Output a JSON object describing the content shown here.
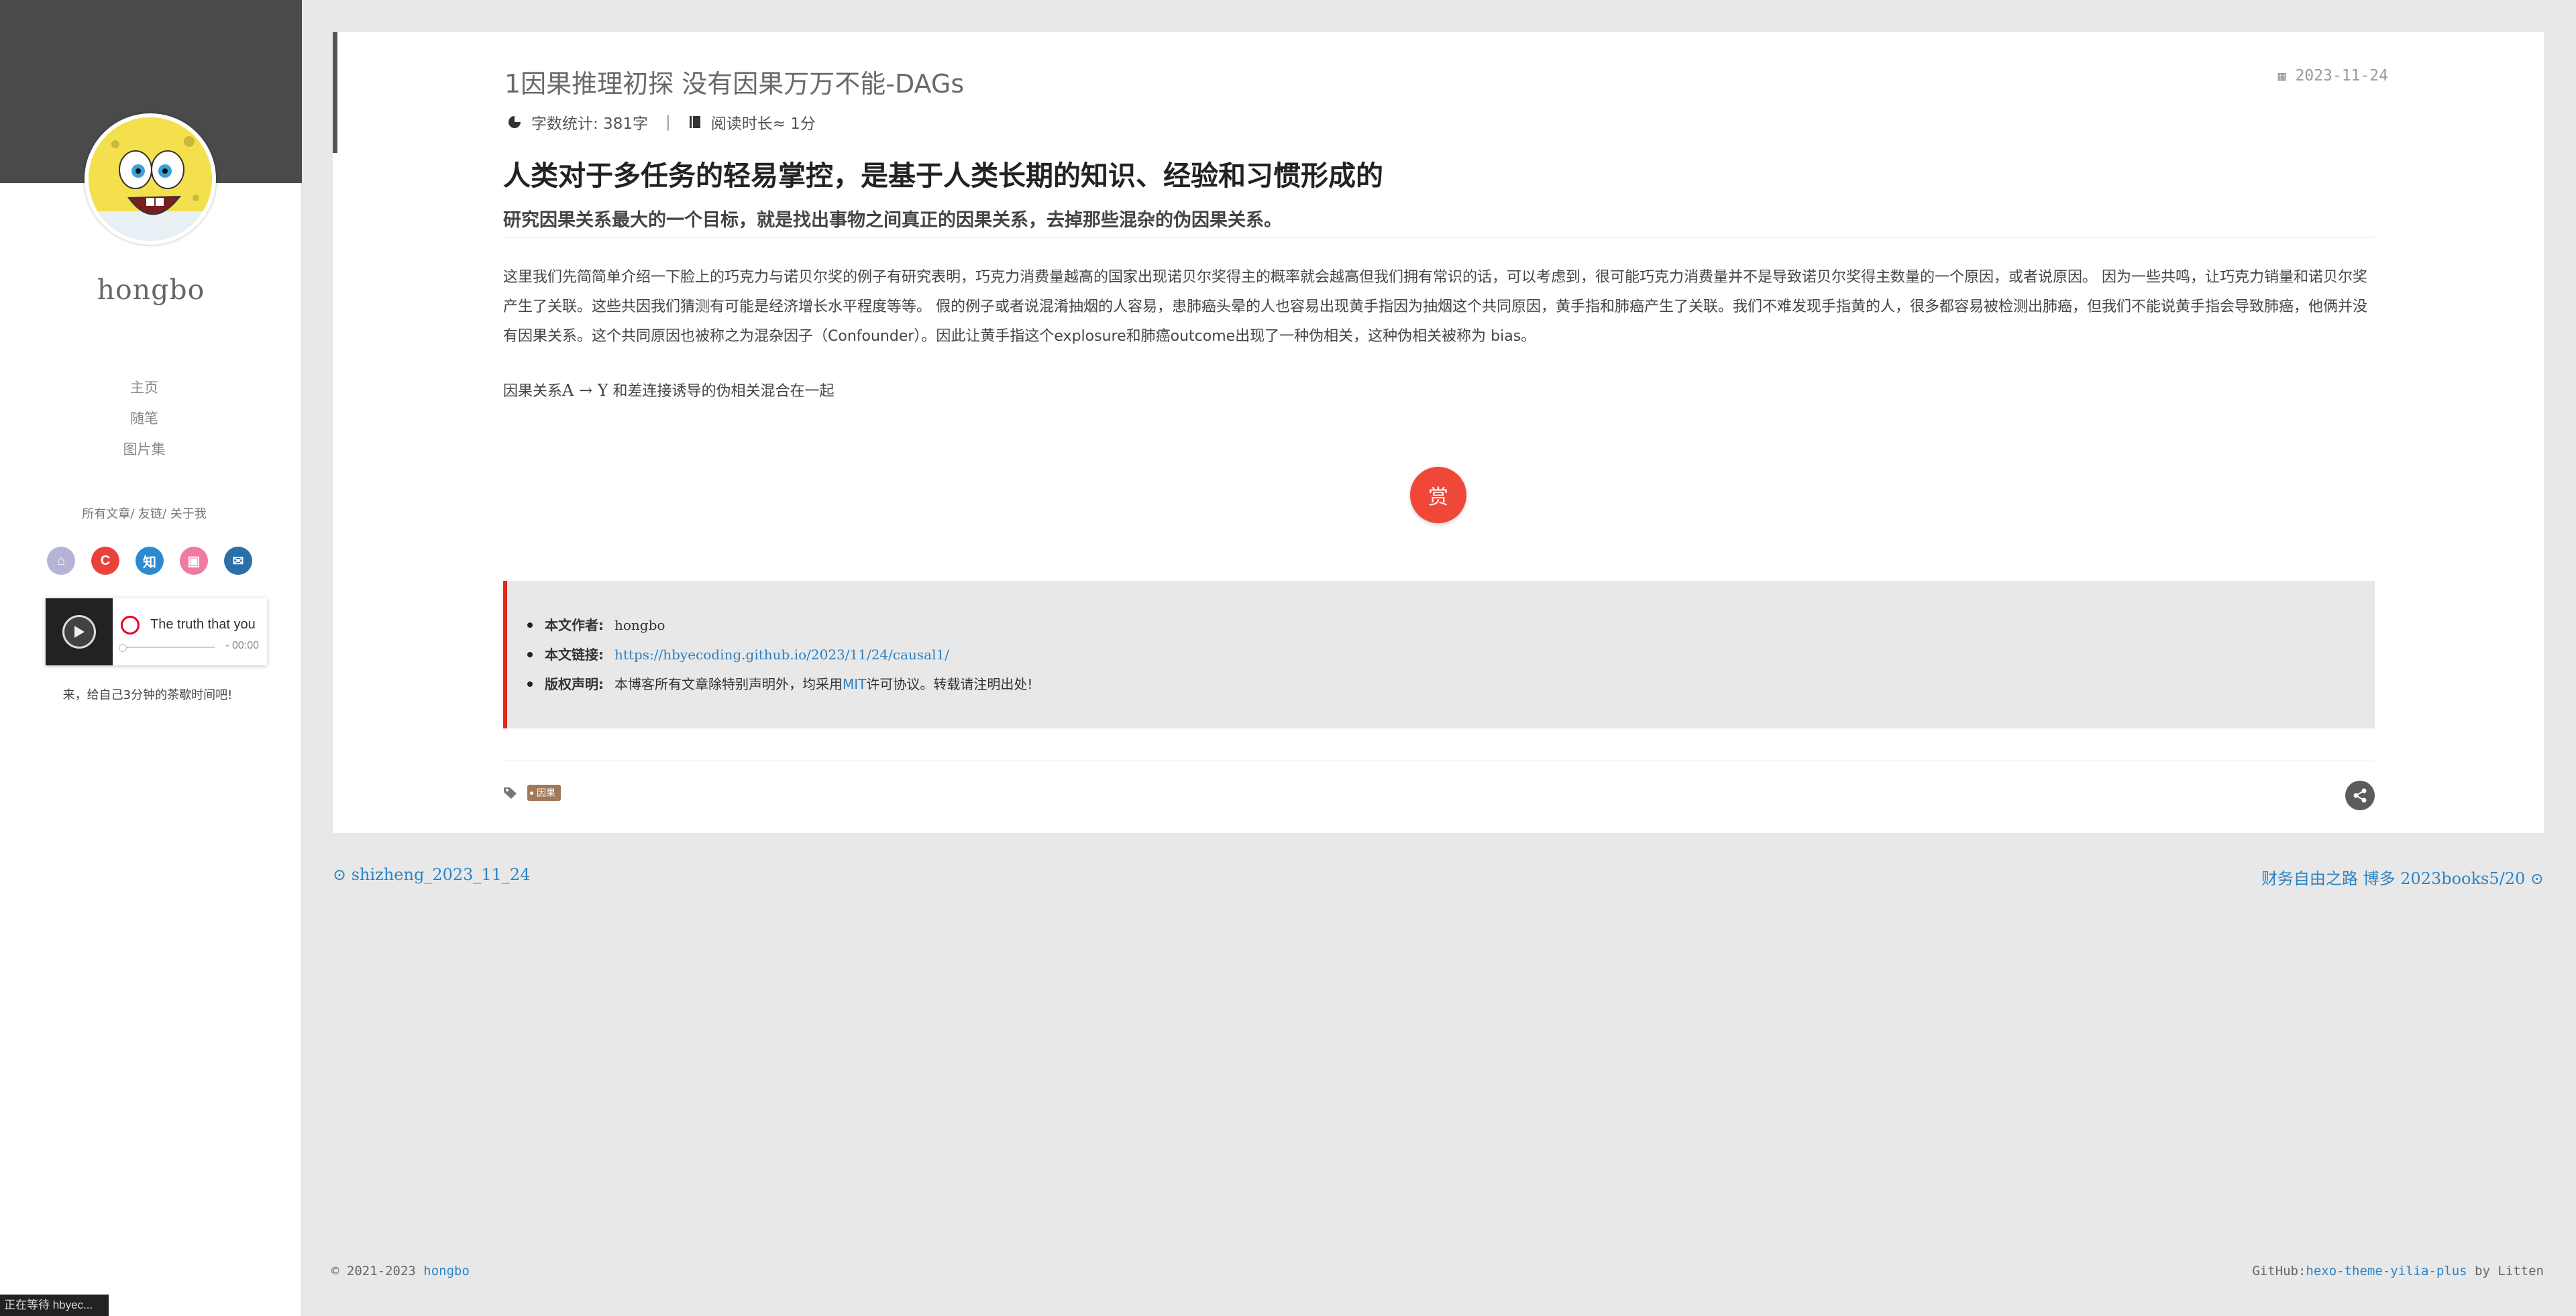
{
  "sidebar": {
    "site_name": "hongbo",
    "nav": [
      "主页",
      "随笔",
      "图片集"
    ],
    "sub_links": [
      "所有文章",
      "友链",
      "关于我"
    ],
    "social_icons": [
      {
        "name": "github-icon",
        "color": "#b5b3d6",
        "glyph": "⌂"
      },
      {
        "name": "csdn-icon",
        "color": "#e8433b",
        "glyph": "C"
      },
      {
        "name": "zhihu-icon",
        "color": "#2e8ad0",
        "glyph": "知"
      },
      {
        "name": "bilibili-icon",
        "color": "#f07aa0",
        "glyph": "▣"
      },
      {
        "name": "email-icon",
        "color": "#2b6fa8",
        "glyph": "✉"
      }
    ],
    "player": {
      "song": "The truth that you",
      "time": "- 00:00"
    },
    "motto": "来，给自己3分钟的茶歇时间吧!"
  },
  "status_text": "正在等待 hbyec...",
  "article": {
    "title": "1因果推理初探 没有因果万万不能-DAGs",
    "date": "2023-11-24",
    "word_count": "字数统计: 381字",
    "read_time": "阅读时长≈ 1分",
    "h1": "人类对于多任务的轻易掌控，是基于人类长期的知识、经验和习惯形成的",
    "h2": "研究因果关系最大的一个目标，就是找出事物之间真正的因果关系，去掉那些混杂的伪因果关系。",
    "para": "这里我们先简简单介绍一下脸上的巧克力与诺贝尔奖的例子有研究表明，巧克力消费量越高的国家出现诺贝尔奖得主的概率就会越高但我们拥有常识的话，可以考虑到，很可能巧克力消费量并不是导致诺贝尔奖得主数量的一个原因，或者说原因。 因为一些共鸣，让巧克力销量和诺贝尔奖产生了关联。这些共因我们猜测有可能是经济增长水平程度等等。 假的例子或者说混淆抽烟的人容易，患肺癌头晕的人也容易出现黄手指因为抽烟这个共同原因，黄手指和肺癌产生了关联。我们不难发现手指黄的人，很多都容易被检测出肺癌，但我们不能说黄手指会导致肺癌，他俩并没有因果关系。这个共同原因也被称之为混杂因子（Confounder）。因此让黄手指这个explosure和肺癌outcome出现了一种伪相关，这种伪相关被称为 bias。",
    "para2_prefix": "因果关系",
    "para2_math": "A → Y",
    "para2_suffix": " 和差连接诱导的伪相关混合在一起",
    "reward": "赏",
    "copyright": {
      "author_label": "本文作者:",
      "author": "hongbo",
      "link_label": "本文链接:",
      "link": "https://hbyecoding.github.io/2023/11/24/causal1/",
      "license_label": "版权声明:",
      "license_pre": "本博客所有文章除特别声明外，均采用 ",
      "license_name": "MIT",
      "license_post": " 许可协议。转载请注明出处!"
    },
    "tag": "因果"
  },
  "pager": {
    "prev": "⊙ shizheng_2023_11_24",
    "next": "财务自由之路 博多 2023books5/20 ⊙"
  },
  "footer": {
    "left_pre": "© 2021-2023 ",
    "left_link": "hongbo",
    "right_pre": "GitHub:",
    "right_link": "hexo-theme-yilia-plus",
    "right_post": " by Litten"
  }
}
